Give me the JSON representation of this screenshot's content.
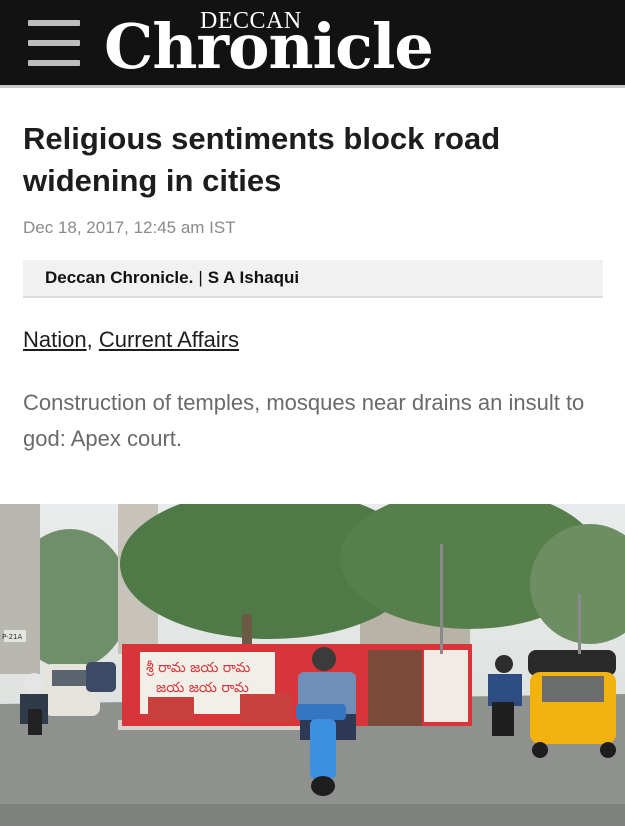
{
  "header": {
    "logo_top": "DECCAN",
    "logo_main": "Chronicle"
  },
  "article": {
    "headline": "Religious sentiments block road widening in cities",
    "timestamp": "Dec 18, 2017, 12:45 am IST",
    "source": "Deccan Chronicle.",
    "separator": "|",
    "author": "S A Ishaqui",
    "categories": [
      "Nation",
      "Current Affairs"
    ],
    "summary": "Construction of temples, mosques near drains an insult to god: Apex court."
  },
  "photo": {
    "wall_text_line1": "శ్రీ రామ జయ రామ",
    "wall_text_line2": "జయ జయ రామ",
    "sign_text": "P-21A"
  },
  "colors": {
    "header_bg": "#121212",
    "wall_red": "#d8353a",
    "auto_yellow": "#f2b311"
  }
}
